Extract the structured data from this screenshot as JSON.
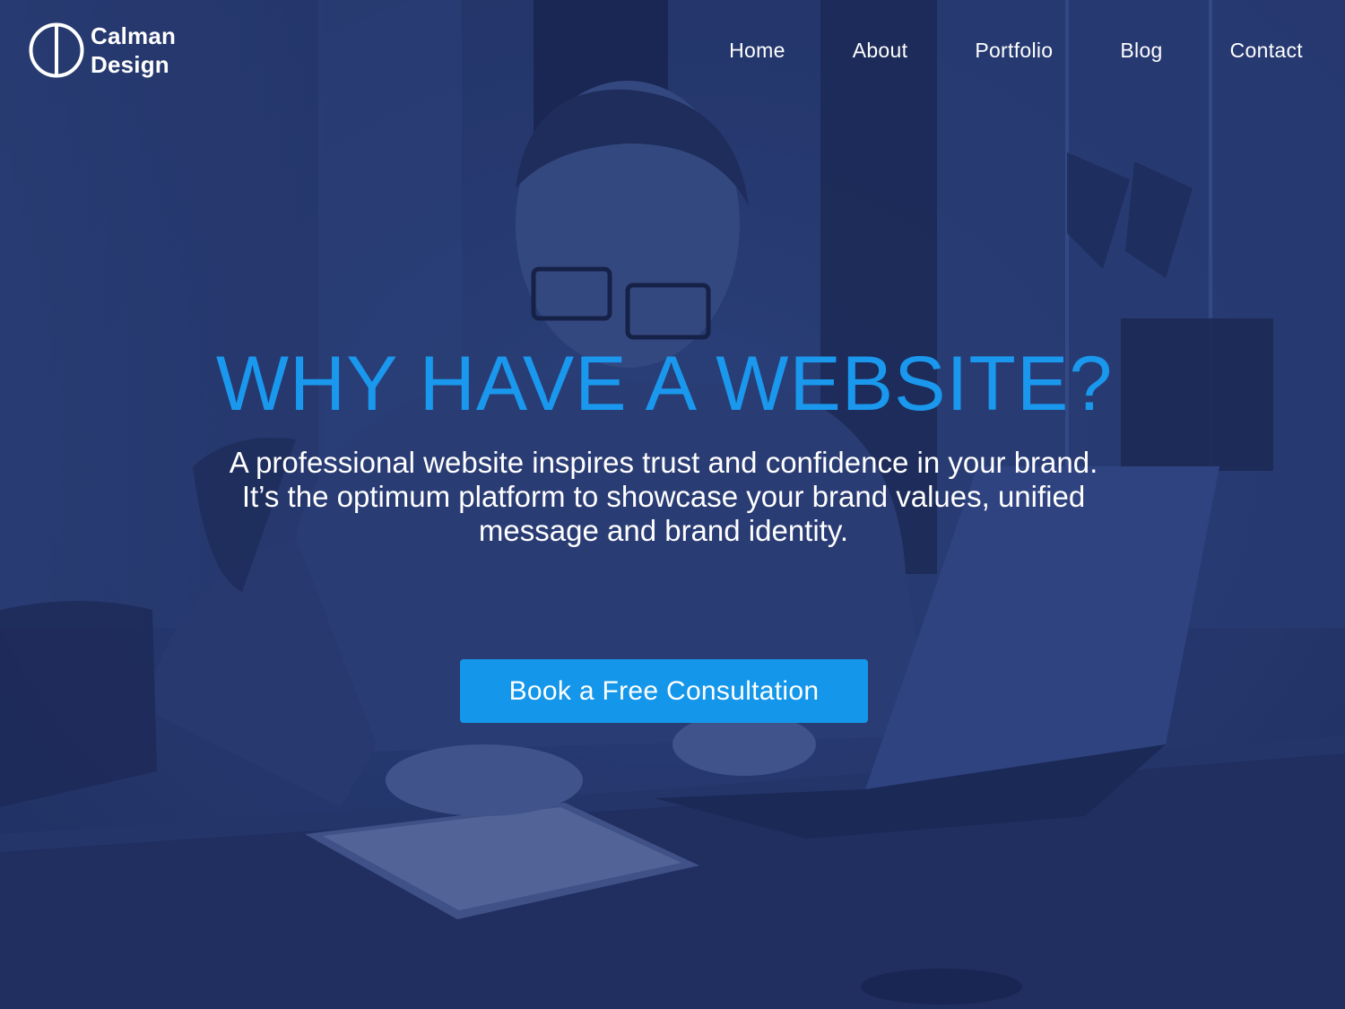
{
  "brand": {
    "name_line1": "Calman",
    "name_line2": "Design",
    "logo_icon": "circle-split-logo"
  },
  "nav": {
    "items": [
      {
        "label": "Home"
      },
      {
        "label": "About"
      },
      {
        "label": "Portfolio"
      },
      {
        "label": "Blog"
      },
      {
        "label": "Contact"
      }
    ]
  },
  "hero": {
    "title": "WHY HAVE A WEBSITE?",
    "subtitle": "A professional website inspires trust and confidence in your brand. It’s the optimum platform to showcase your brand values, unified message and brand identity.",
    "cta_label": "Book a Free Consultation",
    "background_image": "man-with-laptop-and-tablet-at-desk"
  },
  "colors": {
    "overlay": "#25366a",
    "accent": "#1496ea",
    "headline": "#1a98ee",
    "text": "#ffffff"
  }
}
